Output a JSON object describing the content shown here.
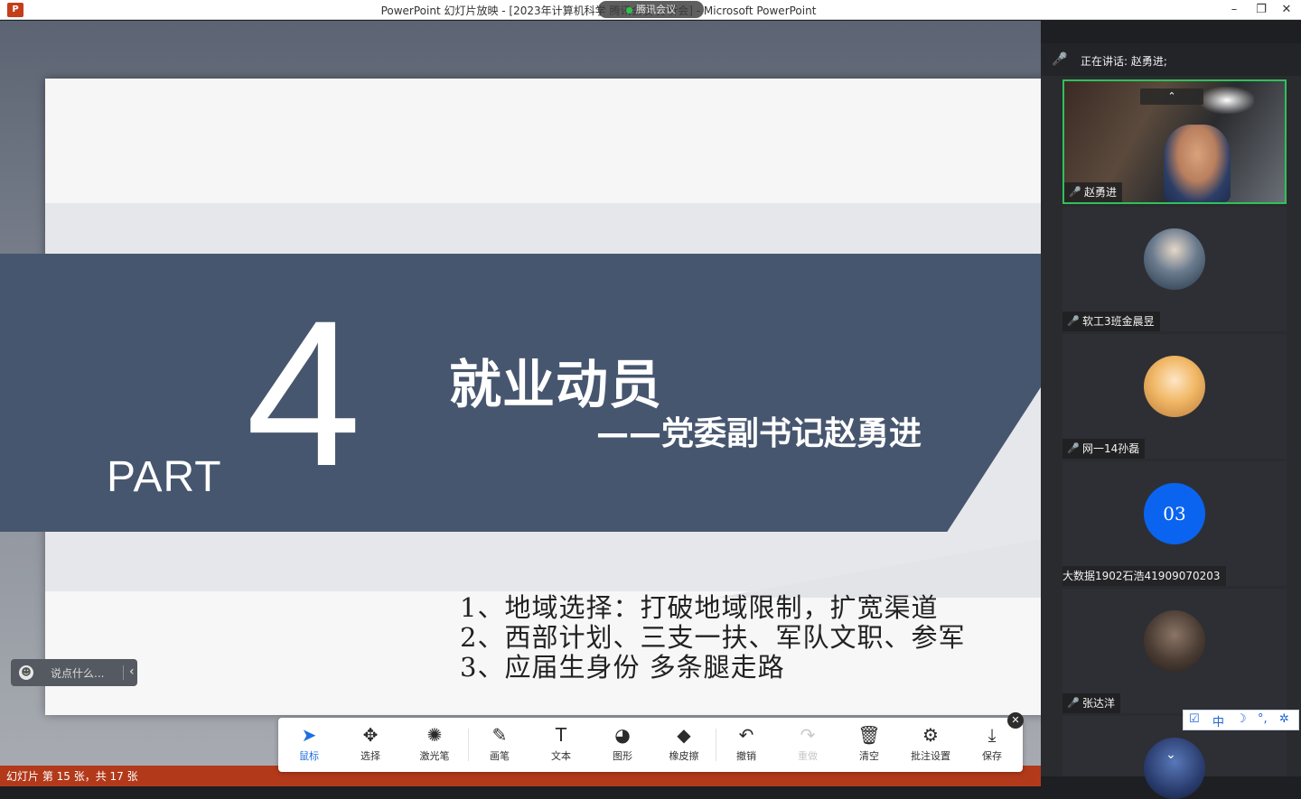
{
  "window": {
    "title": "PowerPoint 幻灯片放映 - [2023年计算机科学  腾讯会议  分析会] - Microsoft PowerPoint",
    "meeting_pill": "腾讯会议",
    "minimize": "–",
    "restore": "❐",
    "close": "✕"
  },
  "slide": {
    "part_label": "PART",
    "number": "4",
    "title": "就业动员",
    "subtitle": "——党委副书记赵勇进",
    "bullets": [
      "1、地域选择：打破地域限制，扩宽渠道",
      "2、西部计划、三支一扶、军队文职、参军",
      "3、应届生身份  多条腿走路"
    ],
    "colors": {
      "band": "#47566f",
      "background": "#f6f6f7"
    }
  },
  "chat": {
    "placeholder": "说点什么..."
  },
  "status_bar": {
    "text": "幻灯片 第 15 张，共 17 张"
  },
  "toolbar": {
    "items": [
      {
        "label": "鼠标",
        "icon": "cursor-icon",
        "glyph": "➤"
      },
      {
        "label": "选择",
        "icon": "move-icon",
        "glyph": "✥"
      },
      {
        "label": "激光笔",
        "icon": "laser-pointer-icon",
        "glyph": "✺"
      },
      {
        "label": "画笔",
        "icon": "pen-icon",
        "glyph": "✎"
      },
      {
        "label": "文本",
        "icon": "text-icon",
        "glyph": "T"
      },
      {
        "label": "图形",
        "icon": "shapes-icon",
        "glyph": "◕"
      },
      {
        "label": "橡皮擦",
        "icon": "eraser-icon",
        "glyph": "◆"
      },
      {
        "label": "撤销",
        "icon": "undo-icon",
        "glyph": "↶"
      },
      {
        "label": "重做",
        "icon": "redo-icon",
        "glyph": "↷"
      },
      {
        "label": "清空",
        "icon": "trash-icon",
        "glyph": "🗑"
      },
      {
        "label": "批注设置",
        "icon": "annotation-settings-icon",
        "glyph": "⚙"
      },
      {
        "label": "保存",
        "icon": "download-icon",
        "glyph": "⤓"
      }
    ],
    "close": "✕"
  },
  "panel": {
    "speaking": "正在讲话: 赵勇进;",
    "participants": [
      {
        "name": "赵勇进",
        "type": "video"
      },
      {
        "name": "软工3班金晨昱",
        "type": "avatar"
      },
      {
        "name": "网一14孙磊",
        "type": "avatar"
      },
      {
        "name": "大数据1902石浩41909070203",
        "type": "initials",
        "initials": "03"
      },
      {
        "name": "张达洋",
        "type": "avatar"
      },
      {
        "name": "",
        "type": "avatar"
      }
    ],
    "accent": "#2fc15a"
  },
  "ime": {
    "lang": "中",
    "moon": "☽",
    "punct": "°,",
    "gear": "✲"
  }
}
